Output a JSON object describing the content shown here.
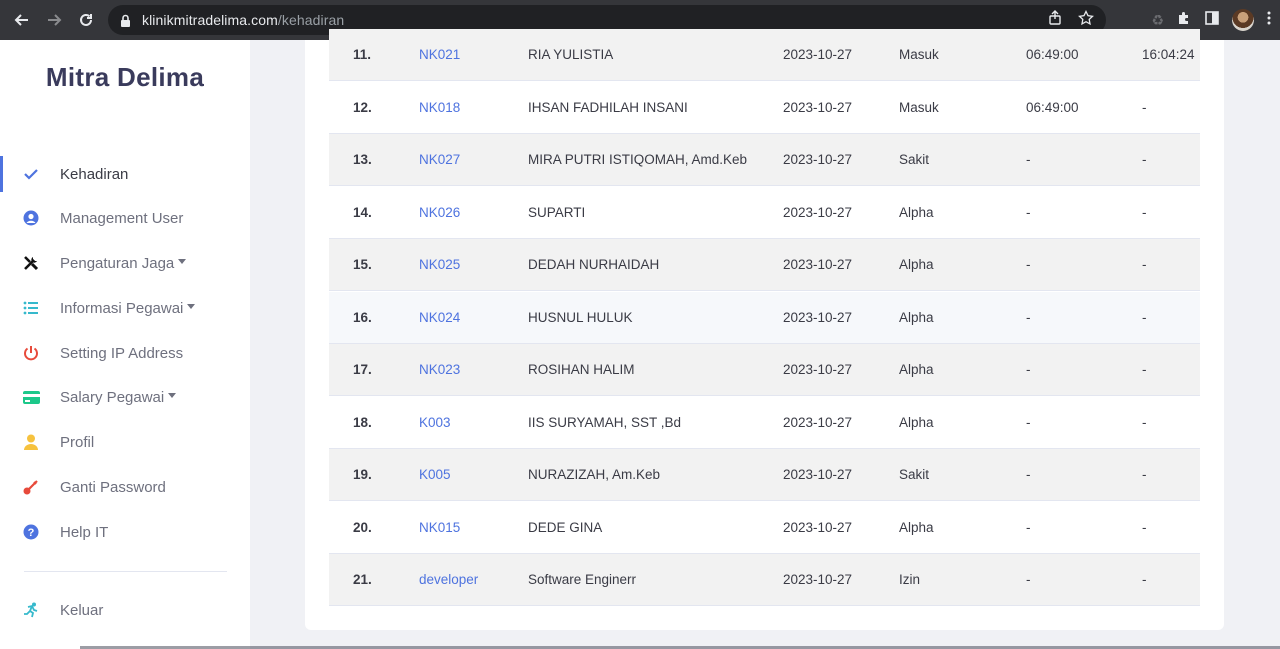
{
  "browser": {
    "url_domain": "klinikmitradelima.com",
    "url_path": "/kehadiran"
  },
  "sidebar": {
    "brand": "Mitra Delima",
    "items": [
      {
        "label": "Kehadiran",
        "icon": "check-icon",
        "color": "#4e73df",
        "dropdown": false
      },
      {
        "label": "Management User",
        "icon": "user-circle-icon",
        "color": "#4e73df",
        "dropdown": false
      },
      {
        "label": "Pengaturan Jaga",
        "icon": "tools-icon",
        "color": "#000000",
        "dropdown": true
      },
      {
        "label": "Informasi Pegawai",
        "icon": "list-icon",
        "color": "#36b9cc",
        "dropdown": true
      },
      {
        "label": "Setting IP Address",
        "icon": "power-icon",
        "color": "#e74a3b",
        "dropdown": false
      },
      {
        "label": "Salary Pegawai",
        "icon": "credit-card-icon",
        "color": "#1cc88a",
        "dropdown": true
      },
      {
        "label": "Profil",
        "icon": "user-icon",
        "color": "#f6c23e",
        "dropdown": false
      },
      {
        "label": "Ganti Password",
        "icon": "key-icon",
        "color": "#e74a3b",
        "dropdown": false
      },
      {
        "label": "Help IT",
        "icon": "question-circle-icon",
        "color": "#4e73df",
        "dropdown": false
      }
    ],
    "logout": {
      "label": "Keluar",
      "icon": "running-icon",
      "color": "#36b9cc"
    }
  },
  "attendance": {
    "rows": [
      {
        "no": "11.",
        "id": "NK021",
        "name": "RIA YULISTIA",
        "date": "2023-10-27",
        "status": "Masuk",
        "in": "06:49:00",
        "out": "16:04:24"
      },
      {
        "no": "12.",
        "id": "NK018",
        "name": "IHSAN FADHILAH INSANI",
        "date": "2023-10-27",
        "status": "Masuk",
        "in": "06:49:00",
        "out": "-"
      },
      {
        "no": "13.",
        "id": "NK027",
        "name": "MIRA PUTRI ISTIQOMAH, Amd.Keb",
        "date": "2023-10-27",
        "status": "Sakit",
        "in": "-",
        "out": "-"
      },
      {
        "no": "14.",
        "id": "NK026",
        "name": "SUPARTI",
        "date": "2023-10-27",
        "status": "Alpha",
        "in": "-",
        "out": "-"
      },
      {
        "no": "15.",
        "id": "NK025",
        "name": "DEDAH NURHAIDAH",
        "date": "2023-10-27",
        "status": "Alpha",
        "in": "-",
        "out": "-"
      },
      {
        "no": "16.",
        "id": "NK024",
        "name": "HUSNUL HULUK",
        "date": "2023-10-27",
        "status": "Alpha",
        "in": "-",
        "out": "-"
      },
      {
        "no": "17.",
        "id": "NK023",
        "name": "ROSIHAN HALIM",
        "date": "2023-10-27",
        "status": "Alpha",
        "in": "-",
        "out": "-"
      },
      {
        "no": "18.",
        "id": "K003",
        "name": "IIS SURYAMAH, SST ,Bd",
        "date": "2023-10-27",
        "status": "Alpha",
        "in": "-",
        "out": "-"
      },
      {
        "no": "19.",
        "id": "K005",
        "name": "NURAZIZAH, Am.Keb",
        "date": "2023-10-27",
        "status": "Sakit",
        "in": "-",
        "out": "-"
      },
      {
        "no": "20.",
        "id": "NK015",
        "name": "DEDE GINA",
        "date": "2023-10-27",
        "status": "Alpha",
        "in": "-",
        "out": "-"
      },
      {
        "no": "21.",
        "id": "developer",
        "name": "Software Enginerr",
        "date": "2023-10-27",
        "status": "Izin",
        "in": "-",
        "out": "-"
      }
    ]
  }
}
